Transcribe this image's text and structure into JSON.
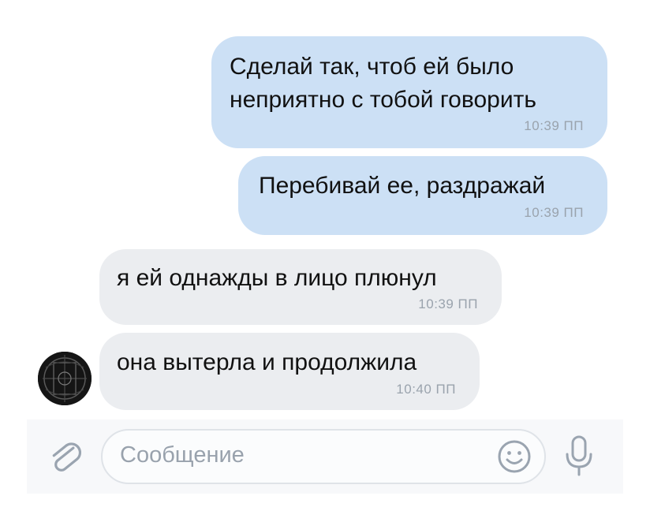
{
  "messages": [
    {
      "direction": "outgoing",
      "lines": [
        "Сделай так, чтоб ей было",
        "неприятно с тобой говорить"
      ],
      "time": "10:39 ПП"
    },
    {
      "direction": "outgoing",
      "lines": [
        "Перебивай ее, раздражай"
      ],
      "time": "10:39 ПП"
    },
    {
      "direction": "incoming",
      "lines": [
        "я ей однажды в лицо плюнул"
      ],
      "time": "10:39 ПП"
    },
    {
      "direction": "incoming",
      "lines": [
        "она вытерла и продолжила"
      ],
      "time": "10:40 ПП"
    }
  ],
  "composer": {
    "placeholder": "Сообщение"
  },
  "icons": {
    "attach": "paperclip-icon",
    "emoji": "smiley-icon",
    "voice": "microphone-icon",
    "avatar": "contact-avatar"
  },
  "colors": {
    "outgoing_bubble": "#cce0f5",
    "incoming_bubble": "#ebedf0",
    "accent": "#99a2ad"
  }
}
